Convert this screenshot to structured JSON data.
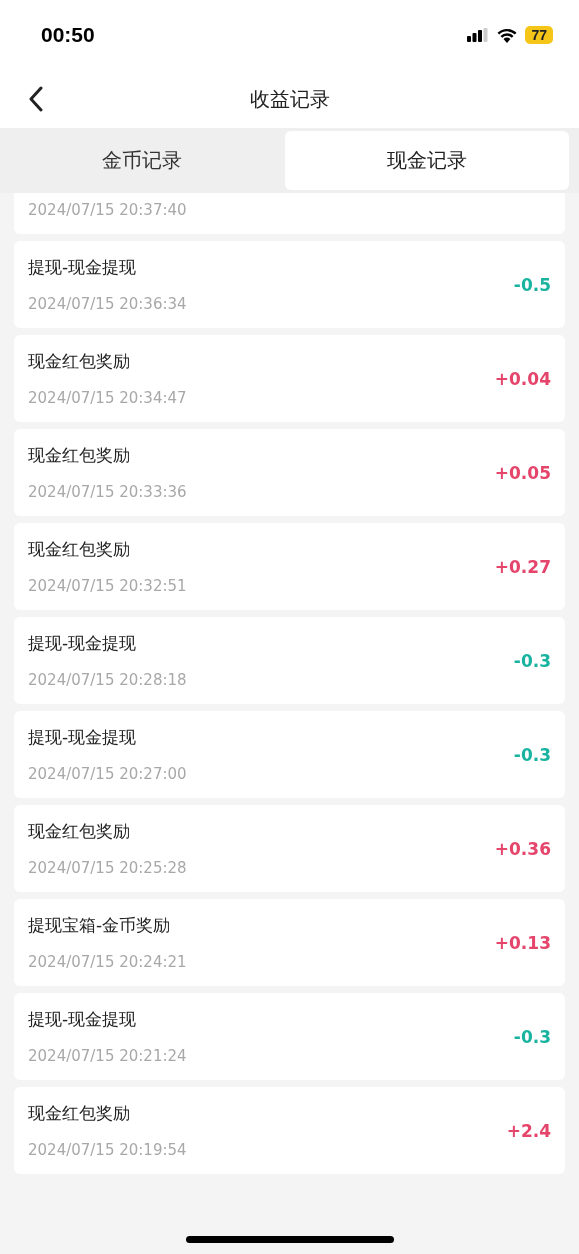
{
  "status_bar": {
    "time": "00:50",
    "battery": "77"
  },
  "nav": {
    "title": "收益记录"
  },
  "tabs": [
    {
      "label": "金币记录",
      "selected": false
    },
    {
      "label": "现金记录",
      "selected": true
    }
  ],
  "records": [
    {
      "time": "2024/07/15 20:37:40"
    },
    {
      "title": "提现-现金提现",
      "time": "2024/07/15 20:36:34",
      "amount": "-0.5",
      "kind": "expense"
    },
    {
      "title": "现金红包奖励",
      "time": "2024/07/15 20:34:47",
      "amount": "+0.04",
      "kind": "income"
    },
    {
      "title": "现金红包奖励",
      "time": "2024/07/15 20:33:36",
      "amount": "+0.05",
      "kind": "income"
    },
    {
      "title": "现金红包奖励",
      "time": "2024/07/15 20:32:51",
      "amount": "+0.27",
      "kind": "income"
    },
    {
      "title": "提现-现金提现",
      "time": "2024/07/15 20:28:18",
      "amount": "-0.3",
      "kind": "expense"
    },
    {
      "title": "提现-现金提现",
      "time": "2024/07/15 20:27:00",
      "amount": "-0.3",
      "kind": "expense"
    },
    {
      "title": "现金红包奖励",
      "time": "2024/07/15 20:25:28",
      "amount": "+0.36",
      "kind": "income"
    },
    {
      "title": "提现宝箱-金币奖励",
      "time": "2024/07/15 20:24:21",
      "amount": "+0.13",
      "kind": "income"
    },
    {
      "title": "提现-现金提现",
      "time": "2024/07/15 20:21:24",
      "amount": "-0.3",
      "kind": "expense"
    },
    {
      "title": "现金红包奖励",
      "time": "2024/07/15 20:19:54",
      "amount": "+2.4",
      "kind": "income"
    }
  ]
}
